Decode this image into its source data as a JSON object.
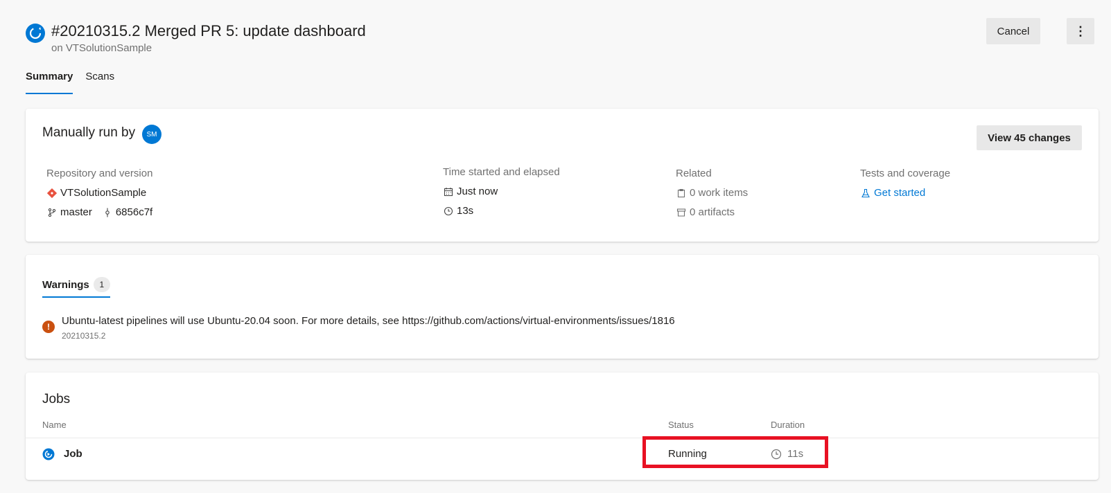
{
  "header": {
    "title": "#20210315.2 Merged PR 5: update dashboard",
    "subtitle": "on VTSolutionSample",
    "cancel_label": "Cancel",
    "more_label": "⋮"
  },
  "tabs": [
    {
      "label": "Summary",
      "active": true
    },
    {
      "label": "Scans",
      "active": false
    }
  ],
  "summary": {
    "manual_run_label": "Manually run by",
    "avatar_initials": "SM",
    "view_changes_label": "View 45 changes",
    "repository": {
      "label": "Repository and version",
      "repo_name": "VTSolutionSample",
      "branch": "master",
      "commit": "6856c7f"
    },
    "time": {
      "label": "Time started and elapsed",
      "started": "Just now",
      "elapsed": "13s"
    },
    "related": {
      "label": "Related",
      "work_items": "0 work items",
      "artifacts": "0 artifacts"
    },
    "tests": {
      "label": "Tests and coverage",
      "link": "Get started"
    }
  },
  "warnings": {
    "tab_label": "Warnings",
    "count": "1",
    "message": "Ubuntu-latest pipelines will use Ubuntu-20.04 soon. For more details, see https://github.com/actions/virtual-environments/issues/1816",
    "source": "20210315.2"
  },
  "jobs": {
    "title": "Jobs",
    "columns": {
      "name": "Name",
      "status": "Status",
      "duration": "Duration"
    },
    "rows": [
      {
        "name": "Job",
        "status": "Running",
        "duration": "11s"
      }
    ]
  },
  "colors": {
    "accent": "#0078d4",
    "warning": "#ca5010",
    "highlight": "#e81123",
    "git": "#e8523f"
  }
}
